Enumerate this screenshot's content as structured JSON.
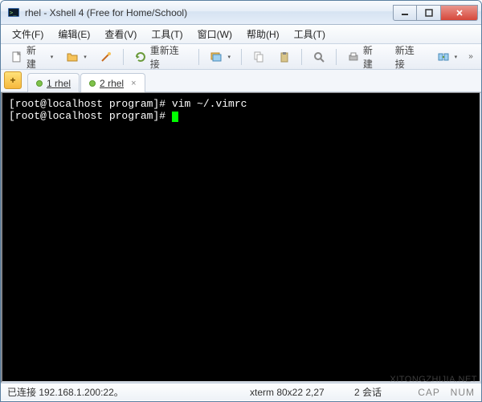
{
  "window": {
    "title": "rhel - Xshell 4 (Free for Home/School)"
  },
  "menu": {
    "file": "文件(F)",
    "edit": "编辑(E)",
    "view": "查看(V)",
    "tools": "工具(T)",
    "window": "窗口(W)",
    "help": "帮助(H)",
    "tools2": "工具(T)"
  },
  "toolbar": {
    "new": "新建",
    "reconnect": "重新连接",
    "new2": "新建",
    "newconn": "新连接"
  },
  "tabs": {
    "add": "+",
    "tab1_num": "1",
    "tab1_label": "rhel",
    "tab2_num": "2",
    "tab2_label": "rhel"
  },
  "terminal": {
    "line1_prompt": "[root@localhost program]#",
    "line1_cmd": " vim ~/.vimrc",
    "line2_prompt": "[root@localhost program]#",
    "line2_cmd": " "
  },
  "status": {
    "connected": "已连接 192.168.1.200:22。",
    "term": "xterm  80x22  2,27",
    "sessions": "2 会话",
    "caps": "CAP　NUM"
  },
  "watermark": "XITONGZHIJIA.NET"
}
